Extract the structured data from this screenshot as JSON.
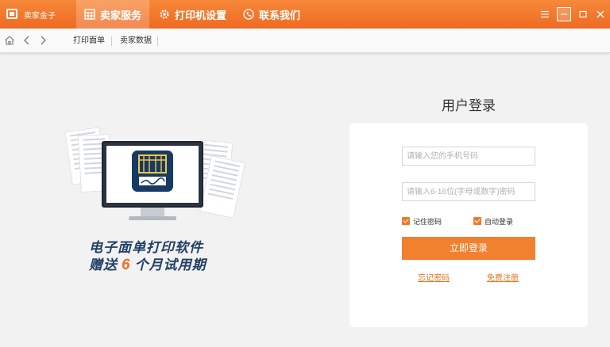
{
  "app": {
    "name": "卖家金子"
  },
  "nav": {
    "tabs": [
      {
        "label": "卖家服务",
        "icon": "grid-icon",
        "active": true
      },
      {
        "label": "打印机设置",
        "icon": "gear-icon",
        "active": false
      },
      {
        "label": "联系我们",
        "icon": "phone-icon",
        "active": false
      }
    ]
  },
  "window_controls": [
    "menu-icon",
    "minimize-icon",
    "maximize-icon",
    "close-icon"
  ],
  "toolbar": {
    "subtabs": [
      "打印面单",
      "卖家数据"
    ]
  },
  "promo": {
    "line1": "电子面单打印软件",
    "line2_prefix": "赠送",
    "line2_number": "6",
    "line2_suffix": "个月试用期"
  },
  "login": {
    "title": "用户登录",
    "phone_placeholder": "请输入您的手机号码",
    "password_placeholder": "请输入6-16位(字母或数字)密码",
    "remember_label": "记住密码",
    "remember_checked": true,
    "auto_login_label": "自动登录",
    "auto_login_checked": true,
    "submit_label": "立即登录",
    "forgot_label": "忘记密码",
    "register_label": "免费注册"
  },
  "colors": {
    "accent": "#f2812f",
    "titlebar": "#ee6a22",
    "navy": "#1f3f63"
  }
}
